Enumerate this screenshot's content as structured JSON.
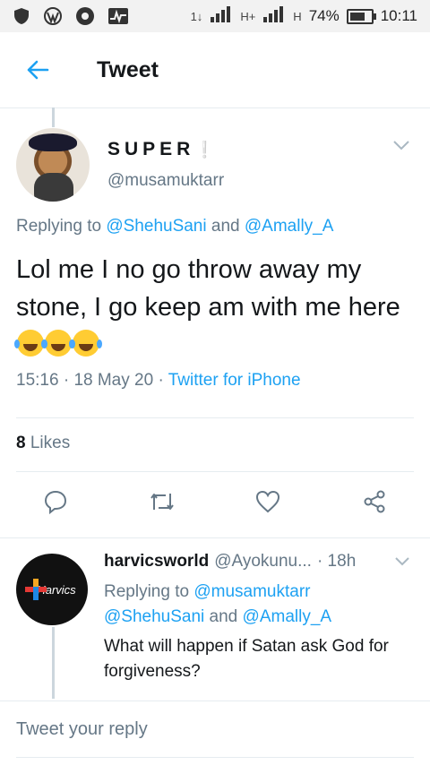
{
  "statusbar": {
    "network_type": "1↓",
    "signal1_label": "H+",
    "signal2_label": "H",
    "battery": "74%",
    "time": "10:11",
    "icons": [
      "shield-icon",
      "wordpress-icon",
      "aperture-icon",
      "activity-icon"
    ]
  },
  "header": {
    "title": "Tweet"
  },
  "tweet": {
    "display_name": "SUPER",
    "name_emoji": "❕",
    "handle": "@musamuktarr",
    "replying_prefix": "Replying to ",
    "replying_user1": "@ShehuSani",
    "replying_and": " and ",
    "replying_user2": "@Amally_A",
    "text": "Lol me I no go throw away my stone, I go keep am with me here",
    "time": "15:16",
    "date": "18 May 20",
    "source": "Twitter for iPhone",
    "likes_count": "8",
    "likes_label": "Likes"
  },
  "reply": {
    "avatar_text": "Harvics",
    "name": "harvicsworld",
    "handle": "@Ayokunu...",
    "time": "· 18h",
    "replying_prefix": "Replying to ",
    "replying_user1": "@musamuktarr",
    "replying_user2": "@ShehuSani",
    "replying_and": " and ",
    "replying_user3": "@Amally_A",
    "text": "What will happen if Satan ask God for forgiveness?"
  },
  "compose": {
    "placeholder": "Tweet your reply"
  },
  "colors": {
    "accent": "#1da1f2",
    "secondary_text": "#657786",
    "divider": "#e6ecf0"
  }
}
